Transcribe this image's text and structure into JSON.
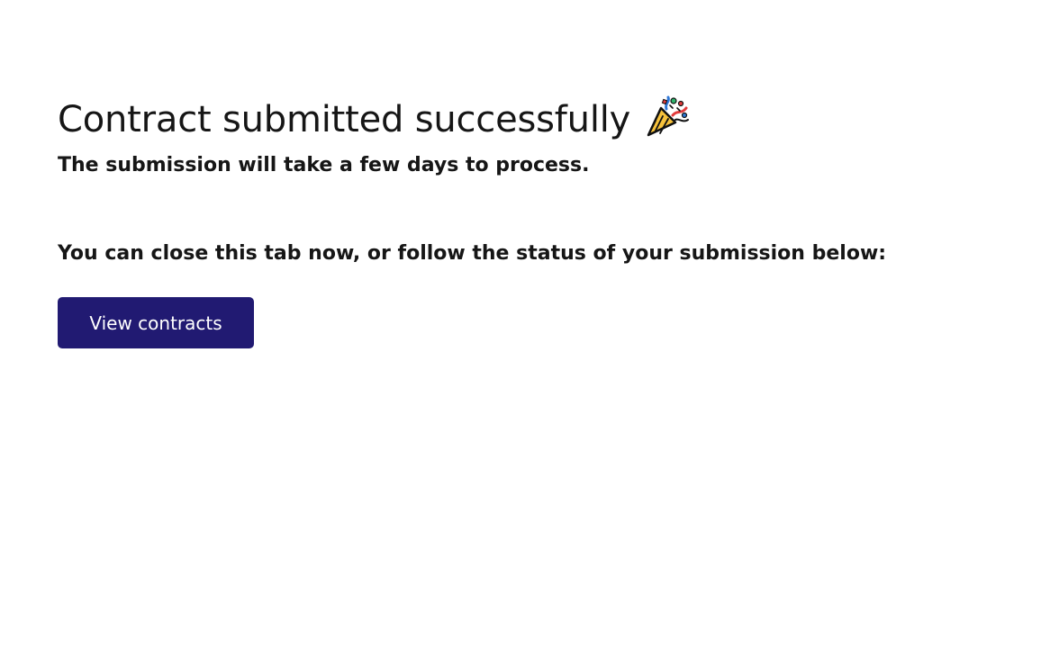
{
  "page": {
    "title": "Contract submitted successfully",
    "subtitle": "The submission will take a few days to process.",
    "instruction": "You can close this tab now, or follow the status of your submission below:",
    "title_icon": "party-popper-icon"
  },
  "actions": {
    "view_contracts_label": "View contracts"
  },
  "colors": {
    "background": "#ffffff",
    "text": "#161616",
    "button_background": "#211a72",
    "button_text": "#ffffff"
  }
}
